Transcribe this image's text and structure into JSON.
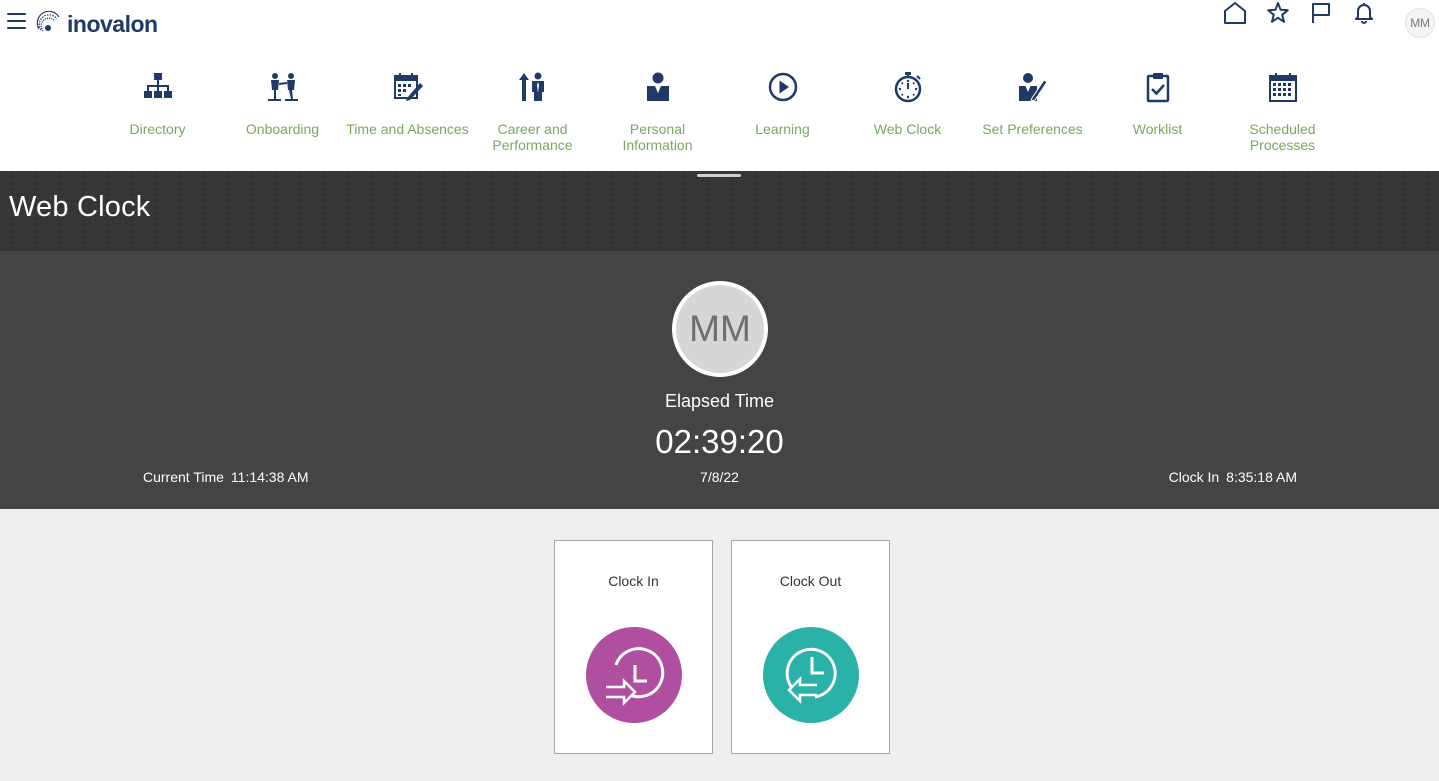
{
  "header": {
    "logo_text": "inovalon",
    "user_initials": "MM",
    "icons": [
      "menu-icon",
      "home-icon",
      "star-icon",
      "flag-icon",
      "bell-icon"
    ]
  },
  "navigator": {
    "items": [
      {
        "label": "Directory",
        "icon": "directory-icon"
      },
      {
        "label": "Onboarding",
        "icon": "onboarding-icon"
      },
      {
        "label": "Time and Absences",
        "icon": "calendar-edit-icon"
      },
      {
        "label": "Career and Performance",
        "icon": "career-icon"
      },
      {
        "label": "Personal Information",
        "icon": "person-icon"
      },
      {
        "label": "Learning",
        "icon": "play-icon"
      },
      {
        "label": "Web Clock",
        "icon": "stopwatch-icon"
      },
      {
        "label": "Set Preferences",
        "icon": "preferences-icon"
      },
      {
        "label": "Worklist",
        "icon": "clipboard-check-icon"
      },
      {
        "label": "Scheduled Processes",
        "icon": "calendar-grid-icon"
      }
    ],
    "label_color": "#78a961",
    "icon_color": "#1f3a66"
  },
  "page": {
    "title": "Web Clock"
  },
  "clock": {
    "user_initials": "MM",
    "elapsed_label": "Elapsed Time",
    "elapsed_value": "02:39:20",
    "current_time_label": "Current Time",
    "current_time_value": "11:14:38 AM",
    "date": "7/8/22",
    "clock_in_label": "Clock In",
    "clock_in_value": "8:35:18 AM"
  },
  "actions": {
    "clock_in": {
      "label": "Clock In",
      "color": "#b04fa0"
    },
    "clock_out": {
      "label": "Clock Out",
      "color": "#2ab2a8"
    }
  }
}
